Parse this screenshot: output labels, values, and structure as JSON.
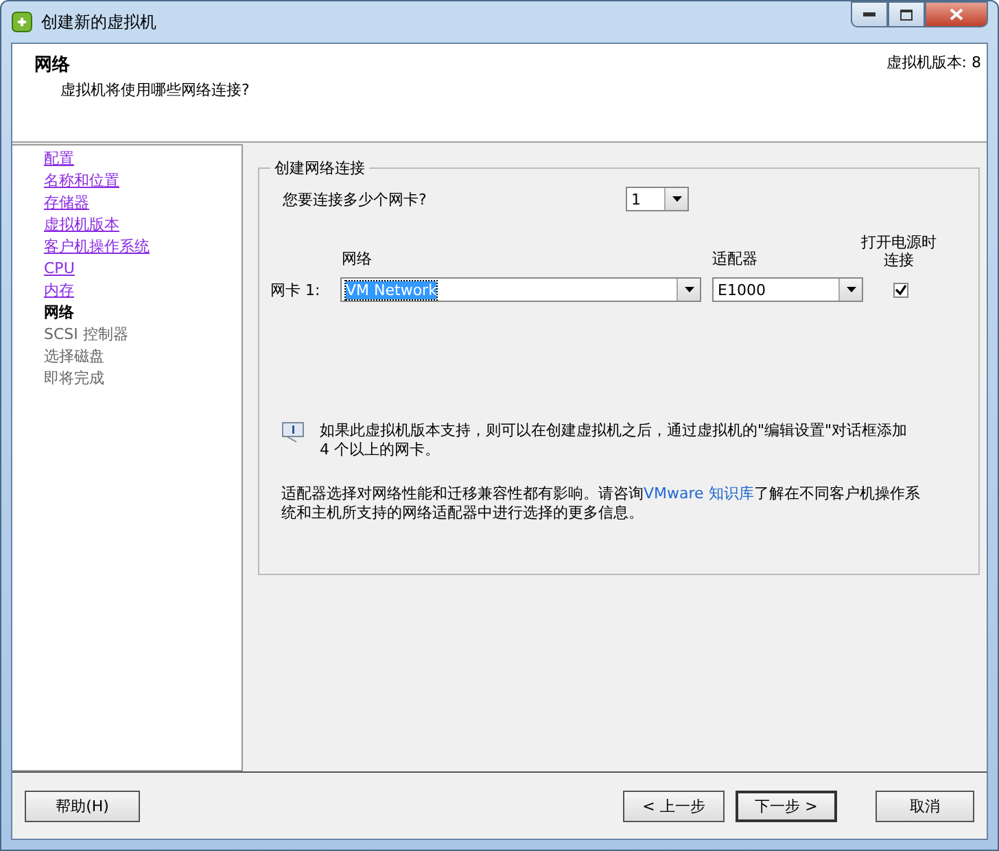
{
  "window": {
    "title": "创建新的虚拟机"
  },
  "header": {
    "title": "网络",
    "subtitle": "虚拟机将使用哪些网络连接?",
    "version": "虚拟机版本: 8"
  },
  "sidebar": {
    "items": [
      {
        "label": "配置",
        "kind": "done"
      },
      {
        "label": "名称和位置",
        "kind": "done"
      },
      {
        "label": "存储器",
        "kind": "done"
      },
      {
        "label": "虚拟机版本",
        "kind": "done"
      },
      {
        "label": "客户机操作系统",
        "kind": "done"
      },
      {
        "label": "CPU",
        "kind": "done"
      },
      {
        "label": "内存",
        "kind": "done"
      },
      {
        "label": "网络",
        "kind": "current"
      },
      {
        "label": "SCSI 控制器",
        "kind": "pending"
      },
      {
        "label": "选择磁盘",
        "kind": "pending"
      },
      {
        "label": "即将完成",
        "kind": "pending"
      }
    ]
  },
  "group": {
    "title": "创建网络连接",
    "nic_count_label": "您要连接多少个网卡?",
    "nic_count": "1",
    "columns": {
      "network": "网络",
      "adapter": "适配器",
      "connect": "打开电源时连接"
    },
    "nics": [
      {
        "label": "网卡 1:",
        "network": "VM Network",
        "adapter": "E1000",
        "connect_at_power_on": true
      }
    ],
    "info": "如果此虚拟机版本支持，则可以在创建虚拟机之后，通过虚拟机的\"编辑设置\"对话框添加 4 个以上的网卡。",
    "note_before": "适配器选择对网络性能和迁移兼容性都有影响。请咨询",
    "note_link": "VMware 知识库",
    "note_after": "了解在不同客户机操作系统和主机所支持的网络适配器中进行选择的更多信息。"
  },
  "buttons": {
    "help": "帮助(H)",
    "back": "< 上一步",
    "next": "下一步 >",
    "cancel": "取消"
  }
}
